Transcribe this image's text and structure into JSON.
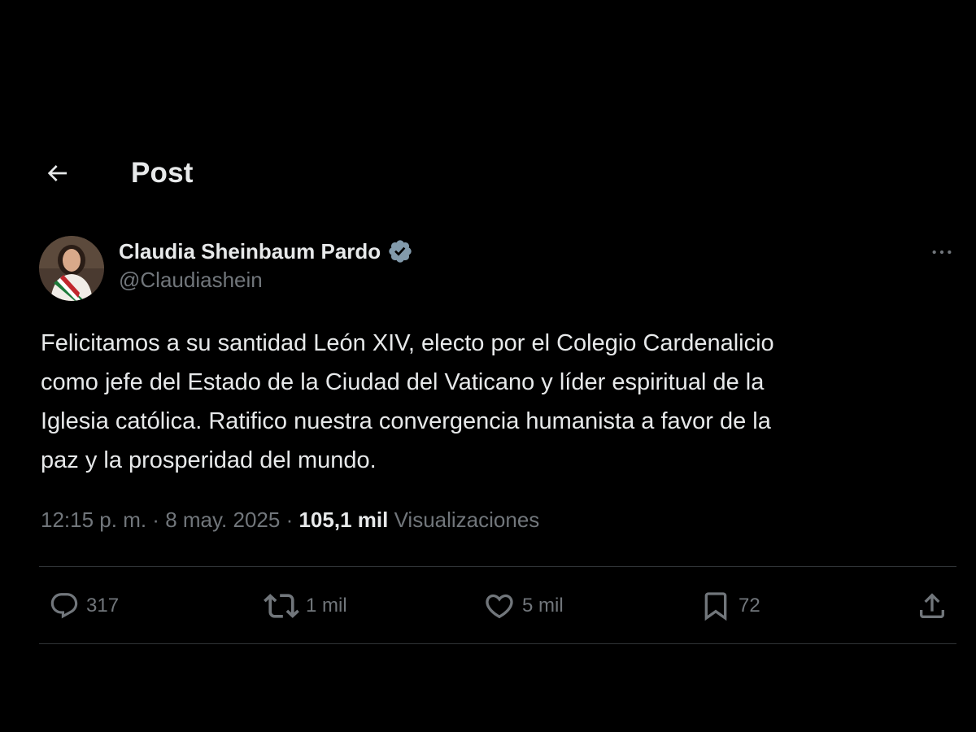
{
  "header": {
    "title": "Post"
  },
  "author": {
    "display_name": "Claudia Sheinbaum Pardo",
    "handle": "@Claudiashein",
    "verified": true
  },
  "tweet": {
    "text": "Felicitamos a su santidad León XIV, electo por el Colegio Cardenalicio\ncomo jefe del Estado de la Ciudad del Vaticano y líder espiritual de la\nIglesia católica. Ratifico nuestra convergencia humanista a favor de la\npaz y la prosperidad del mundo.",
    "time": "12:15 p. m.",
    "separator": " · ",
    "date": "8 may. 2025",
    "views_count": "105,1 mil",
    "views_label": "Visualizaciones"
  },
  "actions": {
    "replies": "317",
    "reposts": "1 mil",
    "likes": "5 mil",
    "bookmarks": "72"
  },
  "icons": {
    "back": "arrow-left-icon",
    "verified": "verified-badge-icon",
    "more": "more-horizontal-icon",
    "reply": "speech-bubble-icon",
    "repost": "repost-icon",
    "like": "heart-icon",
    "bookmark": "bookmark-icon",
    "share": "share-icon"
  },
  "colors": {
    "background": "#000000",
    "text": "#e7e9ea",
    "secondary": "#71767b",
    "divider": "#2f3336",
    "verified_badge": "#829aab"
  }
}
